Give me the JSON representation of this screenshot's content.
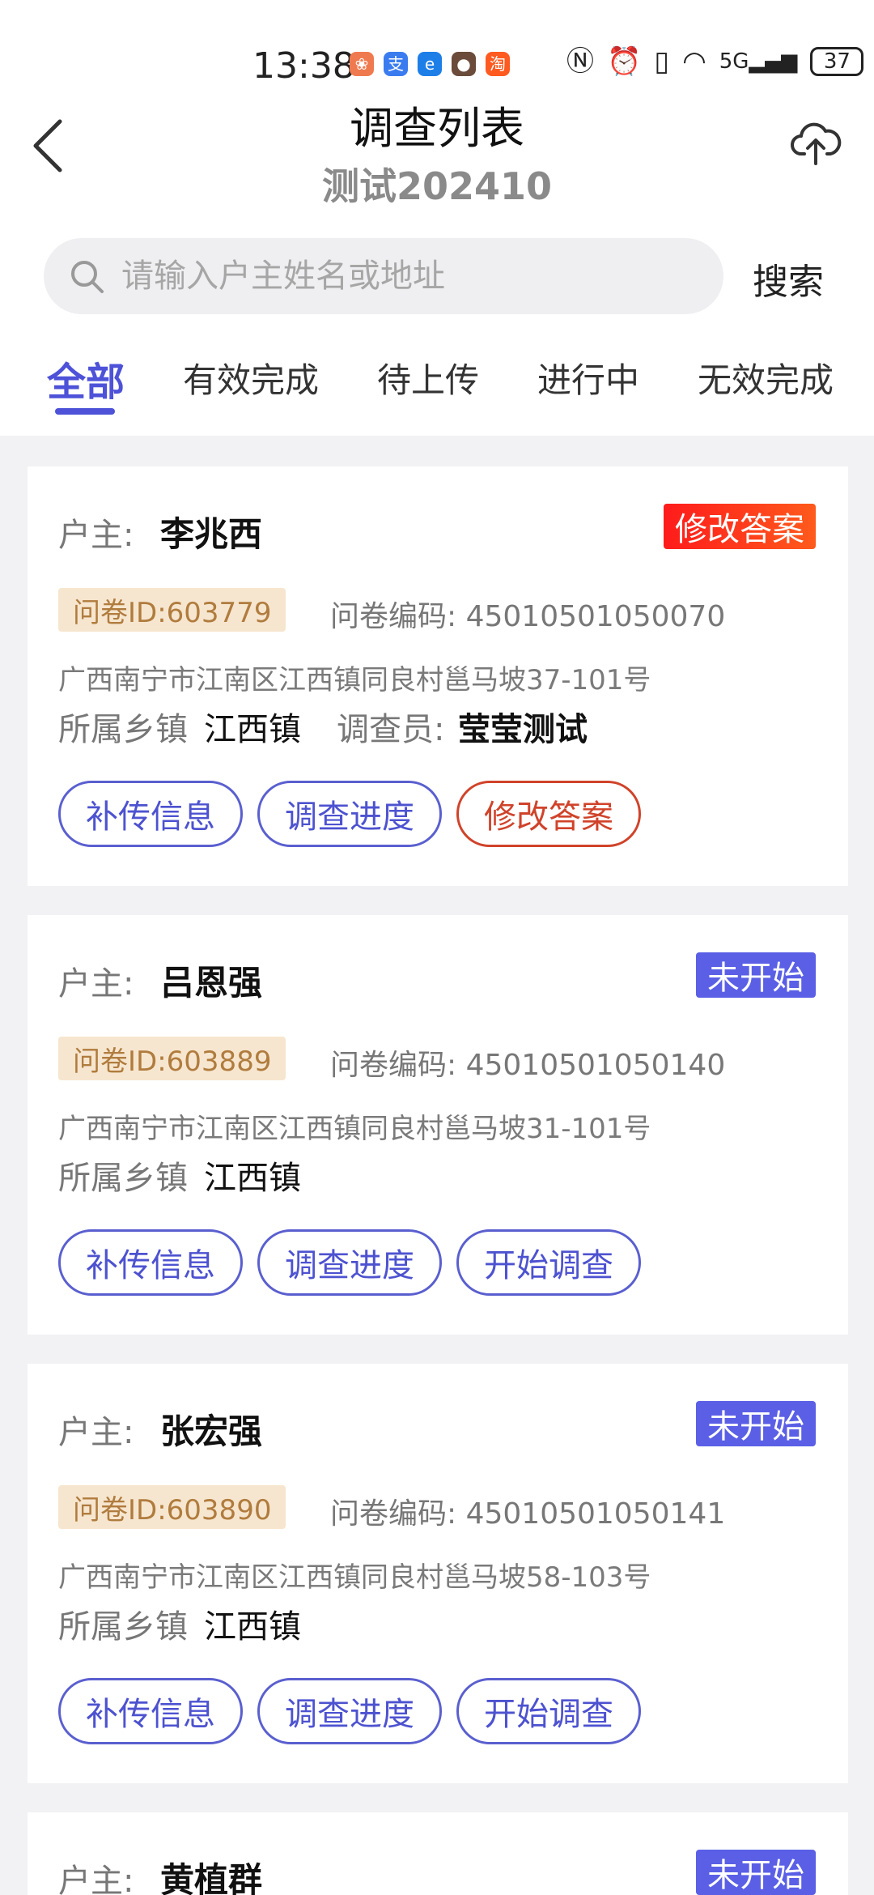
{
  "status_bar": {
    "time": "13:38",
    "battery": "37",
    "network": "5G",
    "apps": [
      {
        "icon": "app-icon-1",
        "glyph": "❀",
        "color": "#f07a4f"
      },
      {
        "icon": "alipay-icon",
        "glyph": "支",
        "color": "#3a7cf0"
      },
      {
        "icon": "browser-icon",
        "glyph": "e",
        "color": "#1e7ee8"
      },
      {
        "icon": "app-icon-4",
        "glyph": "●",
        "color": "#6b4b3a"
      },
      {
        "icon": "taobao-icon",
        "glyph": "淘",
        "color": "#ff5a1f"
      }
    ]
  },
  "header": {
    "title": "调查列表",
    "subtitle": "测试202410"
  },
  "search": {
    "placeholder": "请输入户主姓名或地址",
    "button": "搜索"
  },
  "tabs": [
    "全部",
    "有效完成",
    "待上传",
    "进行中",
    "无效完成"
  ],
  "labels": {
    "owner": "户主:",
    "town": "所属乡镇",
    "surveyor": "调查员:"
  },
  "colors": {
    "accent": "#4d52d8",
    "badge_edit": "#ff2a1a",
    "badge_new": "#5a5fe6",
    "qid_bg": "#f7e6cf"
  },
  "cards": [
    {
      "owner": "李兆西",
      "status": "修改答案",
      "qid": "问卷ID:603779",
      "qcode": "问卷编码: 45010501050070",
      "address": "广西南宁市江南区江西镇同良村邕马坡37-101号",
      "town": "江西镇",
      "surveyor": "莹莹测试",
      "buttons": [
        "补传信息",
        "调查进度",
        "修改答案"
      ]
    },
    {
      "owner": "吕恩强",
      "status": "未开始",
      "qid": "问卷ID:603889",
      "qcode": "问卷编码: 45010501050140",
      "address": "广西南宁市江南区江西镇同良村邕马坡31-101号",
      "town": "江西镇",
      "buttons": [
        "补传信息",
        "调查进度",
        "开始调查"
      ]
    },
    {
      "owner": "张宏强",
      "status": "未开始",
      "qid": "问卷ID:603890",
      "qcode": "问卷编码: 45010501050141",
      "address": "广西南宁市江南区江西镇同良村邕马坡58-103号",
      "town": "江西镇",
      "buttons": [
        "补传信息",
        "调查进度",
        "开始调查"
      ]
    },
    {
      "owner": "黄植群",
      "status": "未开始"
    }
  ]
}
